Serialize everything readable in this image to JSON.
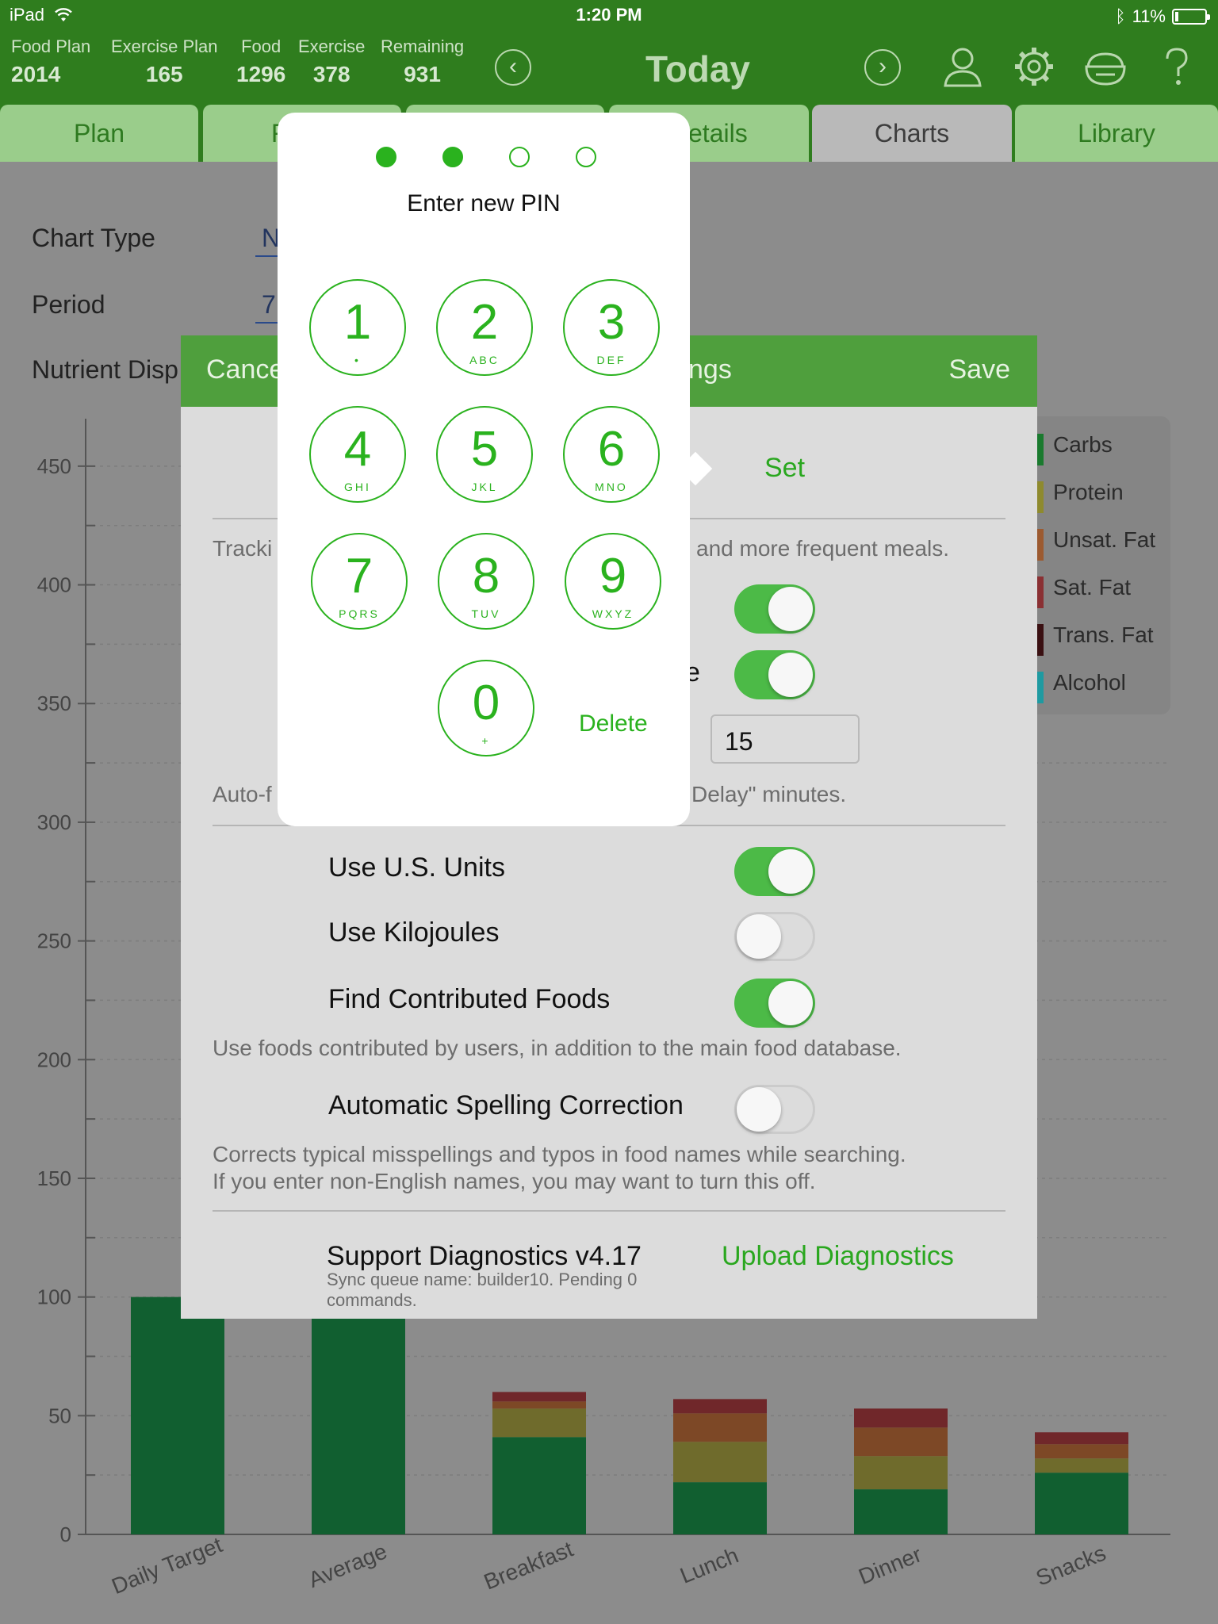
{
  "status_bar": {
    "device": "iPad",
    "time": "1:20 PM",
    "battery": "11%",
    "battery_level": 0.11
  },
  "stats": [
    {
      "label": "Food Plan",
      "value": "2014"
    },
    {
      "label": "Exercise Plan",
      "value": "165"
    },
    {
      "label": "Food",
      "value": "1296"
    },
    {
      "label": "Exercise",
      "value": "378"
    },
    {
      "label": "Remaining",
      "value": "931"
    }
  ],
  "header": {
    "title": "Today",
    "prev_glyph": "‹",
    "next_glyph": "›"
  },
  "toolbar_icons": [
    "person-icon",
    "gear-icon",
    "food-bowl-icon",
    "help-icon"
  ],
  "tabs": [
    {
      "label": "Plan"
    },
    {
      "label": "F"
    },
    {
      "label": ""
    },
    {
      "label": "etails"
    },
    {
      "label": "Charts"
    },
    {
      "label": "Library"
    }
  ],
  "chart_settings": {
    "chart_type_label": "Chart Type",
    "chart_type_value": "N",
    "period_label": "Period",
    "period_value": "7",
    "nutrient_display_label": "Nutrient Disp"
  },
  "chart_data": {
    "type": "bar",
    "stacked": true,
    "categories": [
      "Daily Target",
      "Average",
      "Breakfast",
      "Lunch",
      "Dinner",
      "Snacks"
    ],
    "ylim": [
      0,
      470
    ],
    "yticks": [
      0,
      50,
      100,
      150,
      200,
      250,
      300,
      350,
      400,
      450
    ],
    "series": [
      {
        "name": "Carbs",
        "color": "#115f30",
        "values": [
          100,
          100,
          41,
          22,
          19,
          26
        ]
      },
      {
        "name": "Protein",
        "color": "#6f6b2c",
        "values": [
          0,
          0,
          12,
          17,
          14,
          6
        ]
      },
      {
        "name": "Unsat. Fat",
        "color": "#7d4826",
        "values": [
          0,
          0,
          3,
          12,
          12,
          6
        ]
      },
      {
        "name": "Sat. Fat",
        "color": "#70272a",
        "values": [
          0,
          0,
          4,
          6,
          8,
          5
        ]
      },
      {
        "name": "Trans. Fat",
        "color": "#2d0d0f",
        "values": [
          0,
          0,
          0,
          0,
          0,
          0
        ]
      },
      {
        "name": "Alcohol",
        "color": "#1b7f85",
        "values": [
          0,
          0,
          0,
          0,
          0,
          0
        ]
      }
    ]
  },
  "legend": [
    {
      "label": "Carbs",
      "color": "#1a7a2e"
    },
    {
      "label": "Protein",
      "color": "#8e8a2e"
    },
    {
      "label": "Unsat. Fat",
      "color": "#9c5a30"
    },
    {
      "label": "Sat. Fat",
      "color": "#8a3033"
    },
    {
      "label": "Trans. Fat",
      "color": "#3a1012"
    },
    {
      "label": "Alcohol",
      "color": "#1f9aa1"
    }
  ],
  "settings_sheet": {
    "cancel": "Cance",
    "title": "ngs",
    "save": "Save",
    "set_link": "Set",
    "tracking_prefix": "Tracki",
    "tracking_suffix": "and more frequent meals.",
    "toggle_label_partial": "e",
    "delay_value": "15",
    "auto_prefix": "Auto-f",
    "auto_suffix": "Delay\" minutes.",
    "use_us_units": "Use U.S. Units",
    "use_kilojoules": "Use Kilojoules",
    "find_contributed": "Find Contributed Foods",
    "find_contributed_note": "Use foods contributed by users, in addition to the main food database.",
    "auto_spelling": "Automatic Spelling Correction",
    "auto_spelling_note_1": "Corrects typical misspellings and typos in food names while searching.",
    "auto_spelling_note_2": "If you enter non-English names, you may want to turn this off.",
    "support_diag": "Support Diagnostics v4.17",
    "sync_note_1": "Sync queue name: builder10. Pending 0",
    "sync_note_2": "commands.",
    "upload_diag": "Upload Diagnostics"
  },
  "pin_pad": {
    "title": "Enter new PIN",
    "keys": [
      {
        "digit": "1",
        "letters": "•"
      },
      {
        "digit": "2",
        "letters": "ABC"
      },
      {
        "digit": "3",
        "letters": "DEF"
      },
      {
        "digit": "4",
        "letters": "GHI"
      },
      {
        "digit": "5",
        "letters": "JKL"
      },
      {
        "digit": "6",
        "letters": "MNO"
      },
      {
        "digit": "7",
        "letters": "PQRS"
      },
      {
        "digit": "8",
        "letters": "TUV"
      },
      {
        "digit": "9",
        "letters": "WXYZ"
      },
      {
        "digit": "0",
        "letters": "+"
      }
    ],
    "delete": "Delete",
    "entered_count": 2,
    "pin_length": 4
  }
}
